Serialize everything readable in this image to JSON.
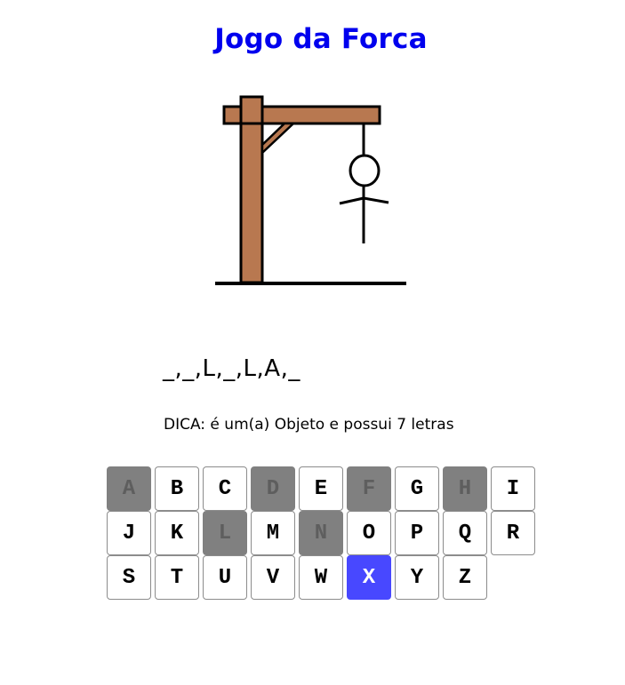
{
  "title": "Jogo da Forca",
  "word_display": "_,_,L,_,L,A,_",
  "hint": "DICA: é um(a) Objeto e possui 7 letras",
  "colors": {
    "title": "#0000ee",
    "gallows_wood": "#b87850",
    "key_used": "#808080",
    "key_active": "#4848ff"
  },
  "keyboard": {
    "rows": [
      [
        {
          "letter": "A",
          "state": "used"
        },
        {
          "letter": "B",
          "state": "available"
        },
        {
          "letter": "C",
          "state": "available"
        },
        {
          "letter": "D",
          "state": "used"
        },
        {
          "letter": "E",
          "state": "available"
        },
        {
          "letter": "F",
          "state": "used"
        },
        {
          "letter": "G",
          "state": "available"
        },
        {
          "letter": "H",
          "state": "used"
        },
        {
          "letter": "I",
          "state": "available"
        }
      ],
      [
        {
          "letter": "J",
          "state": "available"
        },
        {
          "letter": "K",
          "state": "available"
        },
        {
          "letter": "L",
          "state": "used"
        },
        {
          "letter": "M",
          "state": "available"
        },
        {
          "letter": "N",
          "state": "used"
        },
        {
          "letter": "O",
          "state": "available"
        },
        {
          "letter": "P",
          "state": "available"
        },
        {
          "letter": "Q",
          "state": "available"
        },
        {
          "letter": "R",
          "state": "available"
        }
      ],
      [
        {
          "letter": "S",
          "state": "available"
        },
        {
          "letter": "T",
          "state": "available"
        },
        {
          "letter": "U",
          "state": "available"
        },
        {
          "letter": "V",
          "state": "available"
        },
        {
          "letter": "W",
          "state": "available"
        },
        {
          "letter": "X",
          "state": "active"
        },
        {
          "letter": "Y",
          "state": "available"
        },
        {
          "letter": "Z",
          "state": "available"
        }
      ]
    ]
  }
}
